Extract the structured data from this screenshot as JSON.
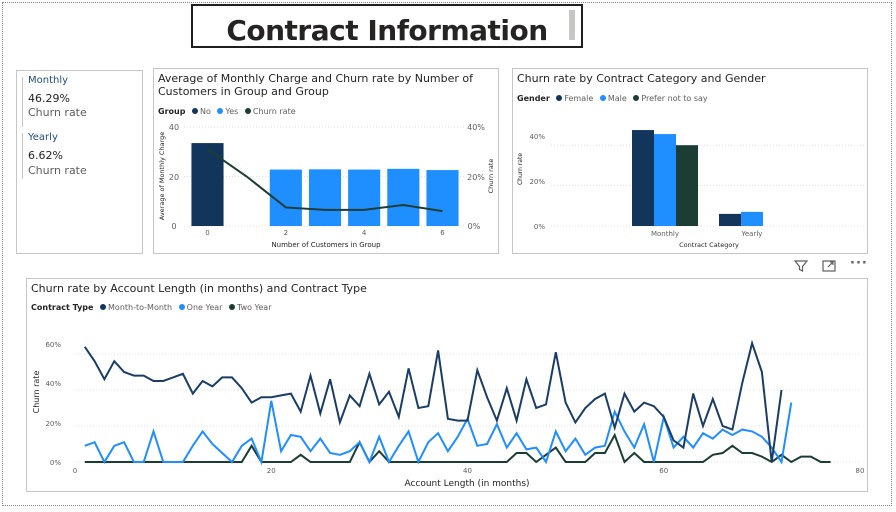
{
  "page": {
    "title": "Contract Information"
  },
  "cards": {
    "monthly": {
      "label": "Monthly",
      "value": "46.29%",
      "sub": "Churn rate"
    },
    "yearly": {
      "label": "Yearly",
      "value": "6.62%",
      "sub": "Churn rate"
    }
  },
  "colors": {
    "navy": "#12355b",
    "blue": "#1f8fff",
    "darkgreen": "#1c3d34",
    "midnavy": "#1a4570"
  },
  "visual_header": {
    "icons": [
      "filter-icon",
      "focus-mode-icon",
      "more-options-icon"
    ],
    "more_label": "···"
  },
  "charts": [
    {
      "title": "Average of Monthly Charge and Churn rate by Number of Customers in Group and Group",
      "title_line1": "Average of Monthly Charge and Churn rate by Number of",
      "title_line2": "Customers in Group and Group",
      "legend_title": "Group",
      "legend": [
        "No",
        "Yes",
        "Churn rate"
      ],
      "xlabel": "Number of Customers in Group",
      "ylabel": "Average of Monthly Charge",
      "y2label": "Churn rate",
      "y_ticks": [
        "40",
        "20",
        "0"
      ],
      "y2_ticks": [
        "40%",
        "20%",
        "0%"
      ],
      "x_ticks": [
        "0",
        "2",
        "4",
        "6"
      ]
    },
    {
      "title": "Churn rate by Contract Category and Gender",
      "legend_title": "Gender",
      "legend": [
        "Female",
        "Male",
        "Prefer not to say"
      ],
      "xlabel": "Contract Category",
      "ylabel": "Churn rate",
      "y_ticks": [
        "40%",
        "20%",
        "0%"
      ],
      "categories": [
        "Monthly",
        "Yearly"
      ]
    },
    {
      "title": "Churn rate by Account Length (in months) and Contract Type",
      "legend_title": "Contract Type",
      "legend": [
        "Month-to-Month",
        "One Year",
        "Two Year"
      ],
      "xlabel": "Account Length (in months)",
      "ylabel": "Churn rate",
      "y_ticks": [
        "60%",
        "40%",
        "20%",
        "0%"
      ],
      "x_ticks": [
        "0",
        "20",
        "40",
        "60",
        "80"
      ]
    }
  ],
  "chart_data": [
    {
      "type": "bar",
      "title": "Average of Monthly Charge and Churn rate by Number of Customers in Group and Group",
      "xlabel": "Number of Customers in Group",
      "ylabel": "Average of Monthly Charge",
      "y2label": "Churn rate",
      "ylim": [
        0,
        40
      ],
      "y2lim": [
        0,
        0.4
      ],
      "xlim": [
        -0.6,
        6.6
      ],
      "legend_position": "top-left",
      "series": [
        {
          "name": "No",
          "x": [
            0
          ],
          "values": [
            33.5
          ]
        },
        {
          "name": "Yes",
          "x": [
            2,
            3,
            4,
            5,
            6
          ],
          "values": [
            22.8,
            22.9,
            22.8,
            23.1,
            22.6
          ]
        },
        {
          "name": "Churn rate",
          "type": "line",
          "x": [
            0,
            1,
            2,
            3,
            4,
            5,
            6
          ],
          "values": [
            0.31,
            0.2,
            0.075,
            0.065,
            0.065,
            0.085,
            0.06
          ]
        }
      ]
    },
    {
      "type": "bar",
      "title": "Churn rate by Contract Category and Gender",
      "xlabel": "Contract Category",
      "ylabel": "Churn rate",
      "ylim": [
        0,
        0.5
      ],
      "legend_position": "top-left",
      "categories": [
        "Monthly",
        "Yearly"
      ],
      "series": [
        {
          "name": "Female",
          "values": [
            0.475,
            0.06
          ]
        },
        {
          "name": "Male",
          "values": [
            0.455,
            0.07
          ]
        },
        {
          "name": "Prefer not to say",
          "values": [
            0.4,
            0
          ]
        }
      ]
    },
    {
      "type": "line",
      "title": "Churn rate by Account Length (in months) and Contract Type",
      "xlabel": "Account Length (in months)",
      "ylabel": "Churn rate",
      "xlim": [
        0,
        80
      ],
      "ylim": [
        0,
        0.7
      ],
      "legend_position": "top-left",
      "series": [
        {
          "name": "Month-to-Month",
          "x": [
            1,
            2,
            3,
            4,
            5,
            6,
            7,
            8,
            9,
            10,
            11,
            12,
            13,
            14,
            15,
            16,
            17,
            18,
            19,
            20,
            21,
            22,
            23,
            24,
            25,
            26,
            27,
            28,
            29,
            30,
            31,
            32,
            33,
            34,
            35,
            36,
            37,
            38,
            39,
            40,
            41,
            42,
            43,
            44,
            45,
            46,
            47,
            48,
            49,
            50,
            51,
            52,
            53,
            54,
            55,
            56,
            57,
            58,
            59,
            60,
            61,
            62,
            63,
            64,
            65,
            66,
            67,
            68,
            69,
            70,
            71,
            72
          ],
          "values": [
            0.64,
            0.56,
            0.46,
            0.56,
            0.5,
            0.48,
            0.48,
            0.45,
            0.45,
            0.47,
            0.49,
            0.38,
            0.45,
            0.42,
            0.47,
            0.47,
            0.41,
            0.33,
            0.36,
            0.36,
            0.37,
            0.38,
            0.28,
            0.48,
            0.27,
            0.46,
            0.22,
            0.37,
            0.31,
            0.49,
            0.32,
            0.39,
            0.25,
            0.52,
            0.3,
            0.31,
            0.62,
            0.24,
            0.23,
            0.23,
            0.51,
            0.36,
            0.23,
            0.41,
            0.23,
            0.46,
            0.3,
            0.32,
            0.61,
            0.33,
            0.22,
            0.3,
            0.35,
            0.38,
            0.19,
            0.38,
            0.28,
            0.33,
            0.31,
            0.25,
            0.12,
            0.08,
            0.38,
            0.2,
            0.35,
            0.2,
            0.18,
            0.44,
            0.66,
            0.5,
            0,
            0.4
          ]
        },
        {
          "name": "One Year",
          "x": [
            1,
            2,
            3,
            4,
            5,
            6,
            7,
            8,
            9,
            10,
            11,
            12,
            13,
            14,
            15,
            16,
            17,
            18,
            19,
            20,
            21,
            22,
            23,
            24,
            25,
            26,
            27,
            28,
            29,
            30,
            31,
            32,
            33,
            34,
            35,
            36,
            37,
            38,
            39,
            40,
            41,
            42,
            43,
            44,
            45,
            46,
            47,
            48,
            49,
            50,
            51,
            52,
            53,
            54,
            55,
            56,
            57,
            58,
            59,
            60,
            61,
            62,
            63,
            64,
            65,
            66,
            67,
            68,
            69,
            70,
            71,
            72,
            73
          ],
          "values": [
            0.09,
            0.11,
            0,
            0.09,
            0.11,
            0,
            0,
            0.17,
            0,
            0,
            0,
            0.09,
            0.17,
            0.1,
            0.05,
            0,
            0.09,
            0.13,
            0,
            0.34,
            0.06,
            0.15,
            0.14,
            0.06,
            0.13,
            0.05,
            0.04,
            0.06,
            0.11,
            0,
            0.14,
            0,
            0.09,
            0.17,
            0,
            0.11,
            0.16,
            0.06,
            0.14,
            0.24,
            0.09,
            0.1,
            0.21,
            0.08,
            0.16,
            0.07,
            0.08,
            0,
            0.17,
            0.06,
            0.13,
            0.04,
            0.08,
            0.09,
            0.28,
            0.17,
            0.08,
            0.21,
            0,
            0.25,
            0.08,
            0.14,
            0.08,
            0.16,
            0.13,
            0.18,
            0.15,
            0.18,
            0.17,
            0.14,
            0.08,
            0,
            0.33
          ]
        },
        {
          "name": "Two Year",
          "x": [
            1,
            2,
            3,
            4,
            5,
            6,
            7,
            8,
            9,
            10,
            11,
            12,
            13,
            14,
            15,
            16,
            17,
            18,
            19,
            20,
            21,
            22,
            23,
            24,
            25,
            26,
            27,
            28,
            29,
            30,
            31,
            32,
            33,
            34,
            35,
            36,
            37,
            38,
            39,
            40,
            41,
            42,
            43,
            44,
            45,
            46,
            47,
            48,
            49,
            50,
            51,
            52,
            53,
            54,
            55,
            56,
            57,
            58,
            59,
            60,
            61,
            62,
            63,
            64,
            65,
            66,
            67,
            68,
            69,
            70,
            71,
            72,
            73,
            74,
            75,
            76,
            77
          ],
          "values": [
            0,
            0,
            0,
            0,
            0,
            0,
            0,
            0,
            0,
            0,
            0,
            0,
            0,
            0,
            0,
            0,
            0,
            0.09,
            0,
            0,
            0,
            0,
            0.04,
            0,
            0,
            0,
            0,
            0,
            0.11,
            0,
            0.06,
            0,
            0,
            0,
            0,
            0,
            0,
            0,
            0,
            0,
            0,
            0,
            0,
            0,
            0.05,
            0.05,
            0,
            0.04,
            0.08,
            0,
            0,
            0,
            0.05,
            0.05,
            0.15,
            0,
            0.05,
            0,
            0,
            0,
            0,
            0,
            0,
            0,
            0.04,
            0.05,
            0.09,
            0.05,
            0.05,
            0.03,
            0,
            0.04,
            0,
            0.03,
            0.03,
            0,
            0
          ]
        }
      ]
    }
  ]
}
